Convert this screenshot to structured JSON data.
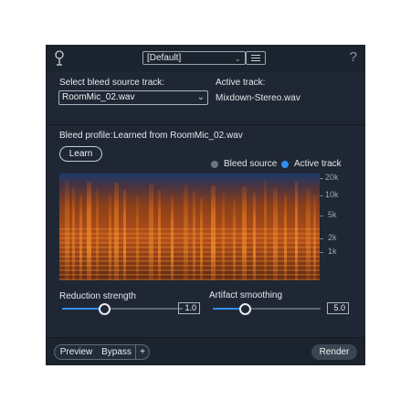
{
  "header": {
    "preset_value": "[Default]",
    "help_symbol": "?"
  },
  "source": {
    "select_label": "Select bleed source track:",
    "selected_track": "RoomMic_02.wav",
    "active_label": "Active track:",
    "active_track": "Mixdown-Stereo.wav"
  },
  "profile": {
    "label": "Bleed profile:",
    "value": "Learned from RoomMic_02.wav",
    "learn_label": "Learn"
  },
  "legend": {
    "bleed_source": "Bleed source",
    "active_track": "Active track",
    "bleed_color": "#6b7580",
    "active_color": "#2f8ef5"
  },
  "spectrogram": {
    "freq_labels": [
      "20k",
      "10k",
      "5k",
      "2k",
      "1k"
    ]
  },
  "controls": {
    "reduction_label": "Reduction strength",
    "reduction_value": "1.0",
    "reduction_fraction": 0.35,
    "smoothing_label": "Artifact smoothing",
    "smoothing_value": "5.0",
    "smoothing_fraction": 0.3
  },
  "footer": {
    "preview_label": "Preview",
    "bypass_label": "Bypass",
    "plus_label": "+",
    "render_label": "Render"
  }
}
